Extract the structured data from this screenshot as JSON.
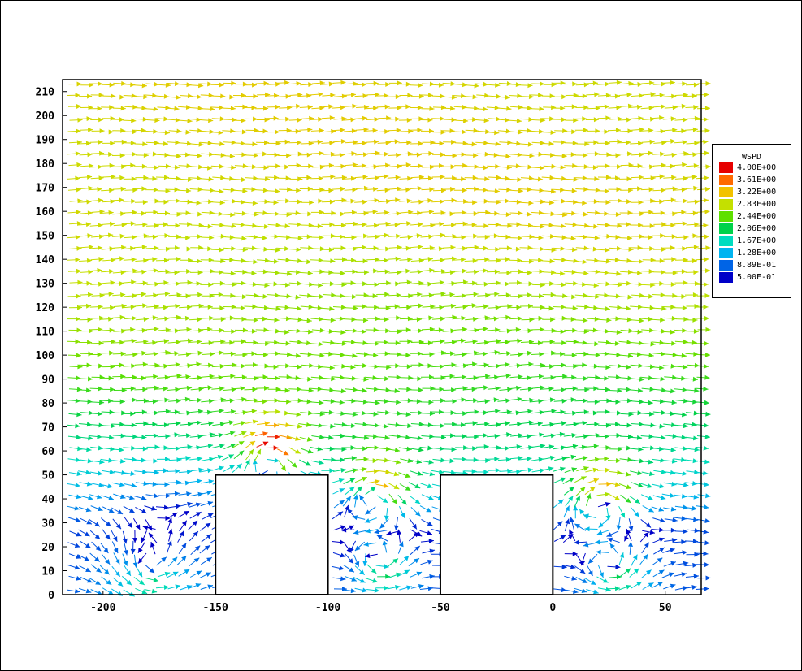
{
  "chart_data": {
    "type": "vector_field",
    "title": "",
    "xlabel": "",
    "ylabel": "",
    "xlim": [
      -218,
      66
    ],
    "ylim": [
      0,
      215
    ],
    "x_ticks": [
      -200,
      -150,
      -100,
      -50,
      0,
      50
    ],
    "y_ticks": [
      0,
      10,
      20,
      30,
      40,
      50,
      60,
      70,
      80,
      90,
      100,
      110,
      120,
      130,
      140,
      150,
      160,
      170,
      180,
      190,
      200,
      210
    ],
    "grid": false,
    "obstacles": [
      {
        "x0": -150,
        "x1": -100,
        "y0": 0,
        "y1": 50
      },
      {
        "x0": -50,
        "x1": 0,
        "y0": 0,
        "y1": 50
      }
    ],
    "vortices": [
      {
        "x": -128,
        "y": 57,
        "rotation": "clockwise"
      },
      {
        "x": -80,
        "y": 41,
        "rotation": "clockwise"
      },
      {
        "x": -78,
        "y": 15,
        "rotation": "counterclockwise"
      },
      {
        "x": 20,
        "y": 38,
        "rotation": "clockwise"
      },
      {
        "x": 25,
        "y": 12,
        "rotation": "counterclockwise"
      },
      {
        "x": -180,
        "y": 12,
        "rotation": "counterclockwise"
      }
    ],
    "legend": {
      "title": "WSPD",
      "placement": "right",
      "entries": [
        {
          "label": "4.00E+00",
          "value": 4.0,
          "color": "#e60000"
        },
        {
          "label": "3.61E+00",
          "value": 3.61,
          "color": "#ff6a00"
        },
        {
          "label": "3.22E+00",
          "value": 3.22,
          "color": "#f2c200"
        },
        {
          "label": "2.83E+00",
          "value": 2.83,
          "color": "#c4e000"
        },
        {
          "label": "2.44E+00",
          "value": 2.44,
          "color": "#5fe000"
        },
        {
          "label": "2.06E+00",
          "value": 2.06,
          "color": "#00d24a"
        },
        {
          "label": "1.67E+00",
          "value": 1.67,
          "color": "#00dcc0"
        },
        {
          "label": "1.28E+00",
          "value": 1.28,
          "color": "#00b4f0"
        },
        {
          "label": "8.89E-01",
          "value": 0.889,
          "color": "#0064e6"
        },
        {
          "label": "5.00E-01",
          "value": 0.5,
          "color": "#0000c8"
        }
      ]
    }
  }
}
